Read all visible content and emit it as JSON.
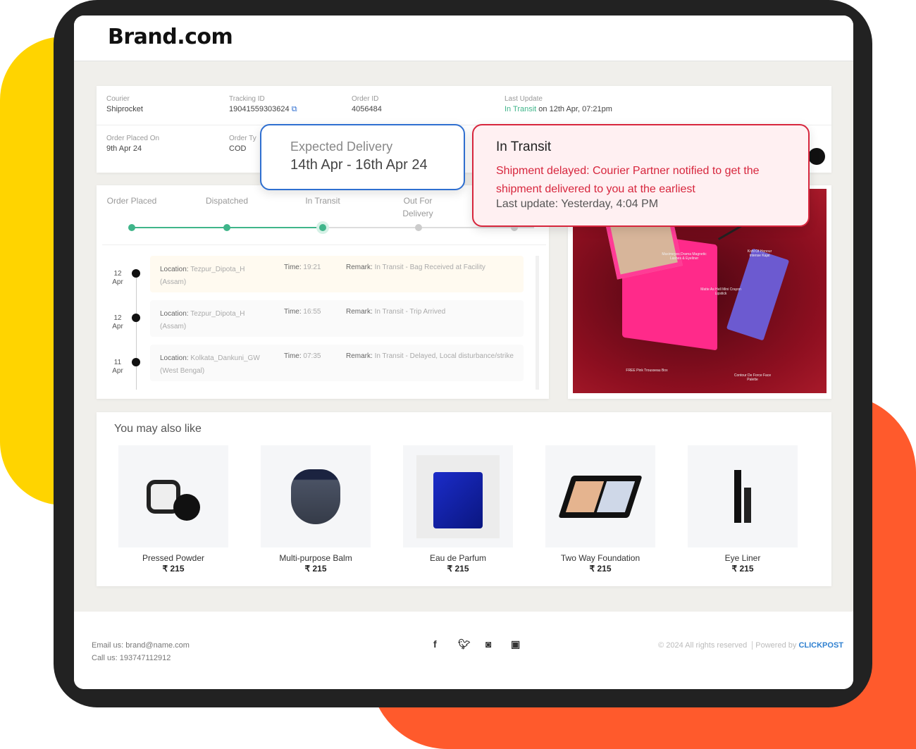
{
  "brand": "Brand.com",
  "info": {
    "courier_label": "Courier",
    "courier": "Shiprocket",
    "tracking_label": "Tracking ID",
    "tracking": "19041559303624",
    "order_label": "Order ID",
    "order": "4056484",
    "last_update_label": "Last Update",
    "last_update_status": "In Transit",
    "last_update_rest": " on 12th Apr, 07:21pm",
    "placed_label": "Order Placed On",
    "placed": "9th Apr 24",
    "type_label": "Order Ty",
    "type": "COD"
  },
  "expected": {
    "label": "Expected Delivery",
    "value": "14th Apr - 16th Apr 24"
  },
  "alert": {
    "title": "In Transit",
    "message": "Shipment delayed: Courier Partner notified to get the shipment delivered to you at the earliest",
    "last_update": "Last update: Yesterday, 4:04 PM"
  },
  "steps": [
    {
      "label": "Order Placed",
      "done": true
    },
    {
      "label": "Dispatched",
      "done": true
    },
    {
      "label": "In Transit",
      "done": true
    },
    {
      "label": "Out For Delivery",
      "done": false
    }
  ],
  "events": [
    {
      "day": "12",
      "month": "Apr",
      "location_label": "Location:",
      "location": "Tezpur_Dipota_H",
      "region": "(Assam)",
      "time_label": "Time:",
      "time": "19:21",
      "remark_label": "Remark:",
      "remark": "In Transit - Bag Received at Facility"
    },
    {
      "day": "12",
      "month": "Apr",
      "location_label": "Location:",
      "location": "Tezpur_Dipota_H",
      "region": "(Assam)",
      "time_label": "Time:",
      "time": "16:55",
      "remark_label": "Remark:",
      "remark": "In Transit - Trip Arrived"
    },
    {
      "day": "11",
      "month": "Apr",
      "location_label": "Location:",
      "location": "Kolkata_Dankuni_GW",
      "region": "(West Bengal)",
      "time_label": "Time:",
      "time": "07:35",
      "remark_label": "Remark:",
      "remark": "In Transit - Delayed, Local disturbance/strike"
    }
  ],
  "promo": {
    "labels": [
      "Maximeyes Drama Magnetic Lashes & Eyeliner",
      "Kohl Of Honour Intense Kajal",
      "Matte As Hell Mini Crayon Lipstick",
      "FREE Pink Trousseau Box",
      "Contour De Force Face Palette"
    ]
  },
  "recommend": {
    "title": "You may also like",
    "products": [
      {
        "name": "Pressed Powder",
        "price": "₹ 215"
      },
      {
        "name": "Multi-purpose Balm",
        "price": "₹ 215"
      },
      {
        "name": "Eau de Parfum",
        "price": "₹ 215"
      },
      {
        "name": "Two Way Foundation",
        "price": "₹ 215"
      },
      {
        "name": "Eye Liner",
        "price": "₹ 215"
      }
    ]
  },
  "footer": {
    "email": "Email us: brand@name.com",
    "call": "Call us: 193747112912",
    "copyright": "© 2024 All rights reserved",
    "powered": "Powered by",
    "powered_brand": "CLICKPOST",
    "social": [
      "facebook",
      "twitter",
      "instagram",
      "youtube"
    ]
  },
  "colors": {
    "accent_green": "#3fb58a",
    "alert_red": "#d7263d",
    "expected_border": "#2f6fd0",
    "clickpost_blue": "#2f80d0"
  }
}
